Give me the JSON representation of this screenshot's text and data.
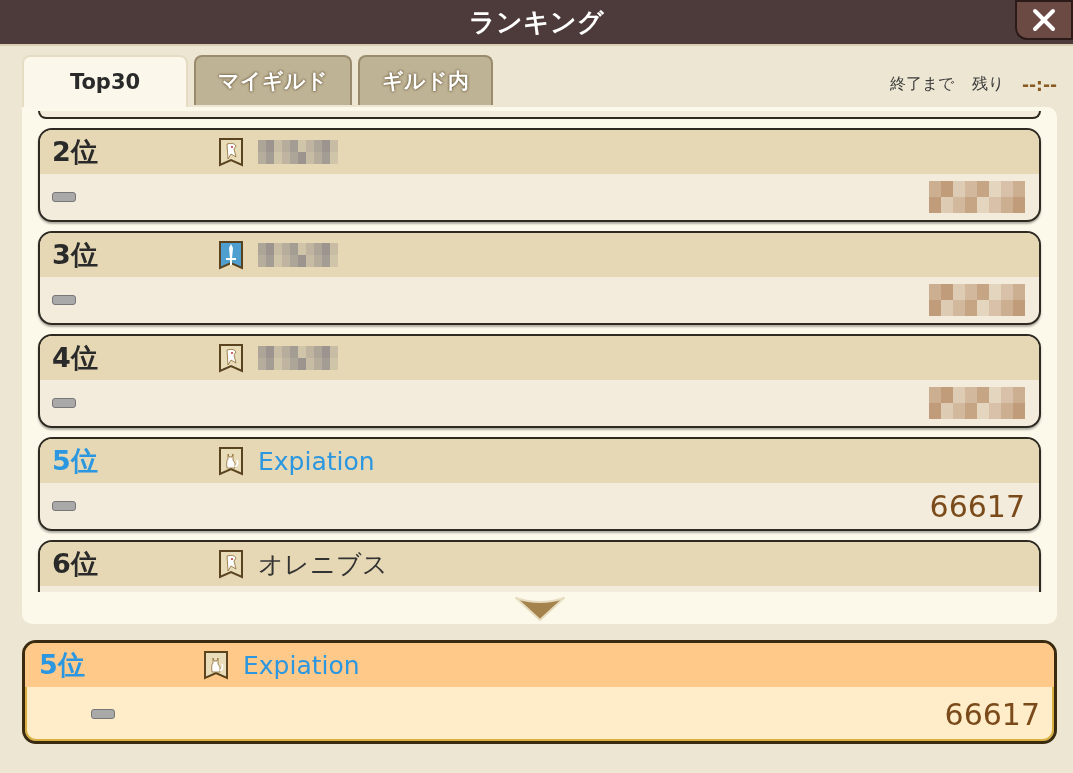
{
  "window": {
    "title": "ランキング"
  },
  "tabs": [
    {
      "label": "Top30",
      "selected": true
    },
    {
      "label": "マイギルド",
      "selected": false
    },
    {
      "label": "ギルド内",
      "selected": false
    }
  ],
  "timer": {
    "label": "終了まで",
    "remaining_label": "残り",
    "value": "--:--"
  },
  "rows": [
    {
      "rank": "2位",
      "kind": "bird",
      "name_hidden": true,
      "self": false
    },
    {
      "rank": "3位",
      "kind": "sword",
      "name_hidden": true,
      "self": false
    },
    {
      "rank": "4位",
      "kind": "bird",
      "name_hidden": true,
      "self": false
    },
    {
      "rank": "5位",
      "kind": "cat",
      "name": "Expiation",
      "score": "66617",
      "name_hidden": false,
      "self": true
    },
    {
      "rank": "6位",
      "kind": "bird",
      "name": "オレニブス",
      "name_hidden": false,
      "self": false
    }
  ],
  "my_rank": {
    "rank": "5位",
    "kind": "cat",
    "name": "Expiation",
    "score": "66617"
  }
}
